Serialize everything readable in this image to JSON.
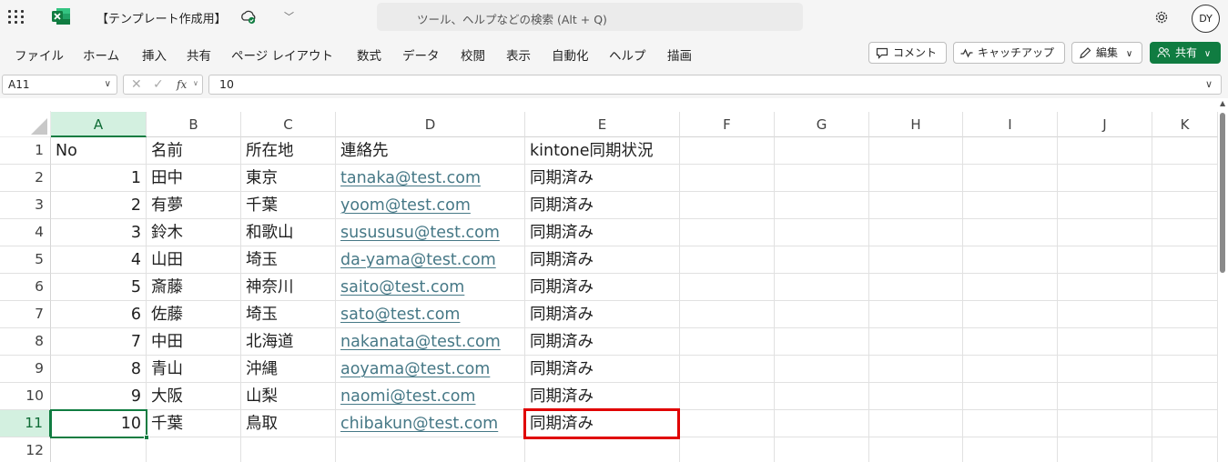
{
  "app": {
    "brand_color": "#107c41",
    "icon": "excel-icon"
  },
  "title": {
    "doc_title": "【テンプレート作成用】",
    "sync_status_icon": "cloud-sync-icon"
  },
  "search": {
    "placeholder": "ツール、ヘルプなどの検索 (Alt + Q)"
  },
  "user": {
    "initials": "DY"
  },
  "ribbon": {
    "tabs": [
      "ファイル",
      "ホーム",
      "挿入",
      "共有",
      "ページ レイアウト",
      "数式",
      "データ",
      "校閲",
      "表示",
      "自動化",
      "ヘルプ",
      "描画"
    ],
    "comment_label": "コメント",
    "catchup_label": "キャッチアップ",
    "edit_label": "編集",
    "share_label": "共有"
  },
  "formula_bar": {
    "name_box": "A11",
    "fx_label": "fx",
    "value": "10"
  },
  "sheet": {
    "columns": [
      "A",
      "B",
      "C",
      "D",
      "E",
      "F",
      "G",
      "H",
      "I",
      "J",
      "K"
    ],
    "selected_column": "A",
    "selected_row": "11",
    "row_numbers": [
      "1",
      "2",
      "3",
      "4",
      "5",
      "6",
      "7",
      "8",
      "9",
      "10",
      "11",
      "12"
    ],
    "rows": [
      [
        "No",
        "名前",
        "所在地",
        "連絡先",
        "kintone同期状況"
      ],
      [
        "1",
        "田中",
        "東京",
        "tanaka@test.com",
        "同期済み"
      ],
      [
        "2",
        "有夢",
        "千葉",
        "yoom@test.com",
        "同期済み"
      ],
      [
        "3",
        "鈴木",
        "和歌山",
        "susususu@test.com",
        "同期済み"
      ],
      [
        "4",
        "山田",
        "埼玉",
        "da-yama@test.com",
        "同期済み"
      ],
      [
        "5",
        "斎藤",
        "神奈川",
        "saito@test.com",
        "同期済み"
      ],
      [
        "6",
        "佐藤",
        "埼玉",
        "sato@test.com",
        "同期済み"
      ],
      [
        "7",
        "中田",
        "北海道",
        "nakanata@test.com",
        "同期済み"
      ],
      [
        "8",
        "青山",
        "沖縄",
        "aoyama@test.com",
        "同期済み"
      ],
      [
        "9",
        "大阪",
        "山梨",
        "naomi@test.com",
        "同期済み"
      ],
      [
        "10",
        "千葉",
        "鳥取",
        "chibakun@test.com",
        "同期済み"
      ]
    ],
    "link_color": "#467886",
    "highlight_color": "#e00000"
  }
}
